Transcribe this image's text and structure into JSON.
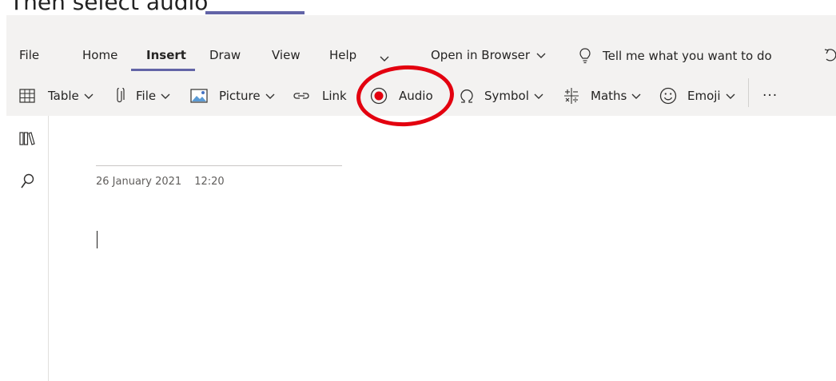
{
  "caption": "Then select audio",
  "menu": {
    "items": [
      "File",
      "Home",
      "Insert",
      "Draw",
      "View",
      "Help"
    ],
    "more_chevron": "⌄",
    "open_in_browser": "Open in Browser",
    "tell_me": "Tell me what you want to do"
  },
  "ribbon": {
    "table": "Table",
    "file": "File",
    "picture": "Picture",
    "link": "Link",
    "audio": "Audio",
    "symbol": "Symbol",
    "maths": "Maths",
    "emoji": "Emoji",
    "more": "···"
  },
  "page": {
    "date": "26 January 2021",
    "time": "12:20"
  },
  "colors": {
    "accent": "#6264a7",
    "record_red": "#e3000f",
    "highlight_red": "#e3000f"
  },
  "icons": {
    "table": "table-icon",
    "file": "paperclip-icon",
    "picture": "picture-icon",
    "link": "link-icon",
    "audio": "record-icon",
    "symbol": "omega-icon",
    "maths": "maths-icon",
    "emoji": "smiley-icon",
    "notebooks": "notebooks-icon",
    "search": "search-icon",
    "lightbulb": "lightbulb-icon",
    "undo": "undo-icon"
  }
}
